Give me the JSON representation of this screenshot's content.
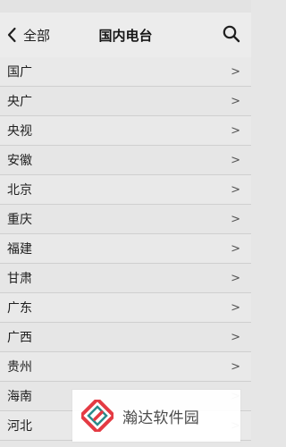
{
  "header": {
    "back_label": "全部",
    "title": "国内电台"
  },
  "list": {
    "items": [
      {
        "label": "国广",
        "chevron": ">"
      },
      {
        "label": "央广",
        "chevron": ">"
      },
      {
        "label": "央视",
        "chevron": ">"
      },
      {
        "label": "安徽",
        "chevron": ">"
      },
      {
        "label": "北京",
        "chevron": ">"
      },
      {
        "label": "重庆",
        "chevron": ">"
      },
      {
        "label": "福建",
        "chevron": ">"
      },
      {
        "label": "甘肃",
        "chevron": ">"
      },
      {
        "label": "广东",
        "chevron": ">"
      },
      {
        "label": "广西",
        "chevron": ">"
      },
      {
        "label": "贵州",
        "chevron": ">"
      },
      {
        "label": "海南",
        "chevron": ">"
      },
      {
        "label": "河北",
        "chevron": ">"
      }
    ]
  },
  "watermark": {
    "text": "瀚达软件园"
  },
  "icons": {
    "back": "chevron-left-icon",
    "search": "search-icon",
    "logo": "watermark-logo-icon"
  },
  "colors": {
    "background": "#e6e6e6",
    "header_background": "#ececec",
    "divider": "#cfcfcf",
    "text": "#202020",
    "logo_red": "#e43a43",
    "logo_teal": "#2b8b8b"
  }
}
